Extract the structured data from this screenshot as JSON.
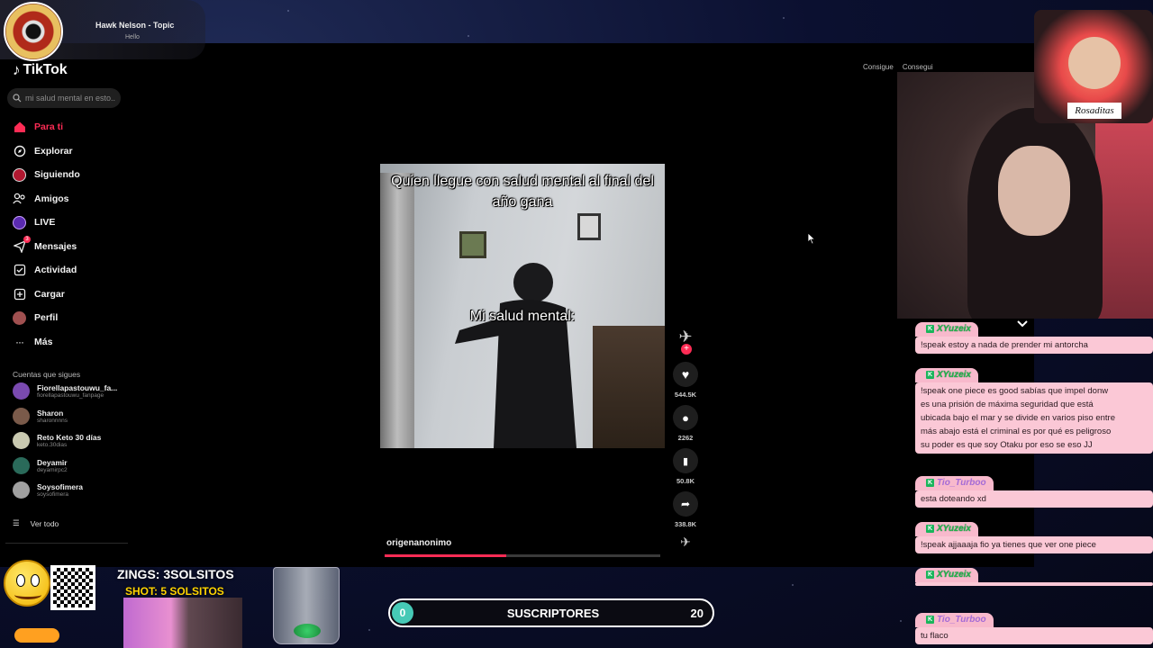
{
  "music": {
    "song": "Hawk Nelson - Topic",
    "subtitle": "Hello"
  },
  "tiktok": {
    "logo": "TikTok",
    "search_placeholder": "mi salud mental en esto...",
    "nav": [
      {
        "label": "Para ti",
        "icon": "home-icon",
        "active": true
      },
      {
        "label": "Explorar",
        "icon": "compass-icon"
      },
      {
        "label": "Siguiendo",
        "icon": "following-icon"
      },
      {
        "label": "Amigos",
        "icon": "friends-icon"
      },
      {
        "label": "LIVE",
        "icon": "live-icon"
      },
      {
        "label": "Mensajes",
        "icon": "messages-icon",
        "badge": "3"
      },
      {
        "label": "Actividad",
        "icon": "activity-icon"
      },
      {
        "label": "Cargar",
        "icon": "upload-icon"
      },
      {
        "label": "Perfil",
        "icon": "profile-icon"
      },
      {
        "label": "Más",
        "icon": "more-icon"
      }
    ],
    "following_heading": "Cuentas que sigues",
    "accounts": [
      {
        "name": "Fiorellapastouwu_fa...",
        "handle": "fiorellapastouwu_fanpage",
        "color": "#7a4ab0"
      },
      {
        "name": "Sharon",
        "handle": "sharonnnns",
        "color": "#7a5a4a"
      },
      {
        "name": "Reto Keto 30 días",
        "handle": "keto.30dias",
        "color": "#c9c9b0"
      },
      {
        "name": "Deyamir",
        "handle": "deyamirpc2",
        "color": "#2a6a5a"
      },
      {
        "name": "Soysofimera",
        "handle": "soysofimera",
        "color": "#a0a0a0"
      }
    ],
    "see_all": "Ver todo",
    "video": {
      "caption_top": "Quien llegue con salud mental al final del año gana",
      "caption_mid": "Mi salud mental:",
      "author": "origenanonimo",
      "progress": 0.44
    },
    "actions": {
      "likes": "544.5K",
      "comments": "2262",
      "saves": "50.8K",
      "shares": "338.8K"
    },
    "top_buttons": [
      "Consigue",
      "Consegui"
    ]
  },
  "streamer_label": "Rosaditas",
  "chat": [
    {
      "user": "XYuzeix",
      "text": "!speak estoy a nada de prender mi antorcha"
    },
    {
      "user": "XYuzeix",
      "text": "!speak one piece es good sabías que impel donw\nes una prisión de máxima seguridad que está\nubicada bajo el mar y se divide en varios piso entre\nmás abajo está el criminal es por qué es peligroso\nsu poder es que soy Otaku por eso se eso JJ"
    },
    {
      "user": "Tio_Turboo",
      "text": "esta doteando xd"
    },
    {
      "user": "XYuzeix",
      "text": "!speak ajjaaaja fio ya tienes que ver one piece"
    },
    {
      "user": "XYuzeix",
      "text": ""
    },
    {
      "user": "Tio_Turboo",
      "text": "tu flaco"
    }
  ],
  "overlay": {
    "zings": "ZINGS: 3SOLSITOS",
    "shot": "SHOT: 5 SOLSITOS",
    "subs_current": "0",
    "subs_label": "SUSCRIPTORES",
    "subs_goal": "20",
    "subs_progress": 0
  }
}
